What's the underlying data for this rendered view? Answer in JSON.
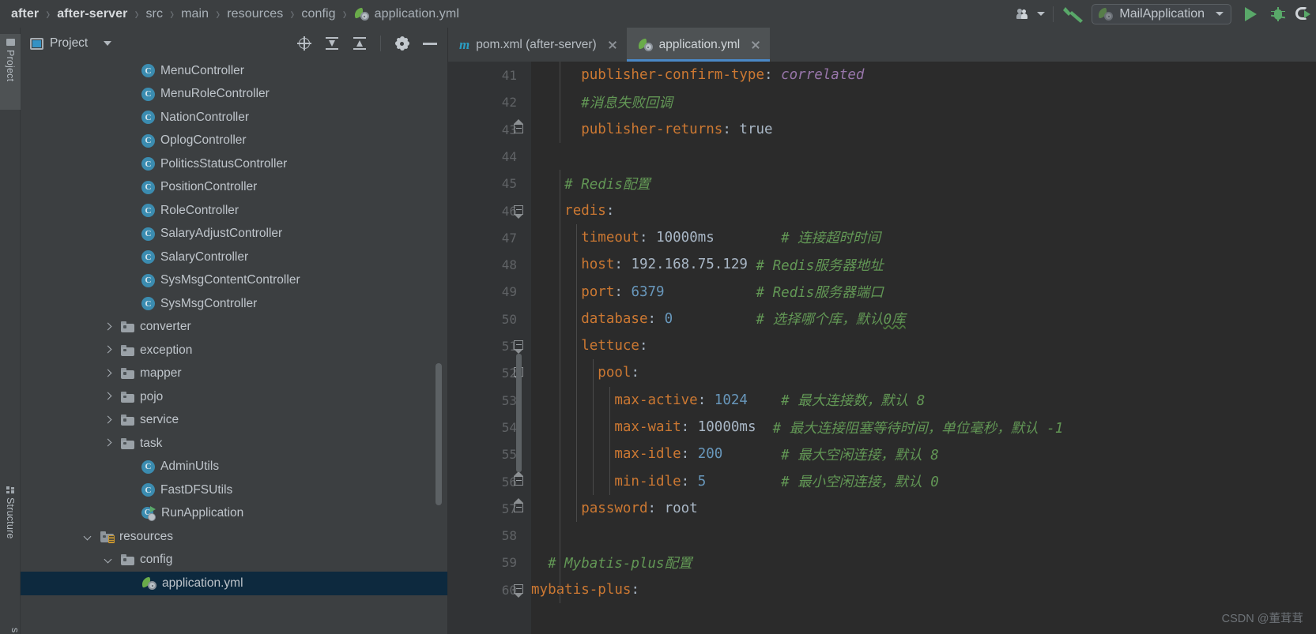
{
  "breadcrumb": {
    "items": [
      "after",
      "after-server",
      "src",
      "main",
      "resources",
      "config"
    ],
    "file": "application.yml",
    "separator": "›"
  },
  "toolbar": {
    "people_icon": "people-icon",
    "build_icon": "hammer-icon",
    "run_config": "MailApplication",
    "run_icon": "run-icon",
    "debug_icon": "debug-icon",
    "coverage_icon": "coverage-icon"
  },
  "left_strip": {
    "project_label": "Project",
    "structure_label": "Structure",
    "bottom_label": "s"
  },
  "project_panel": {
    "title": "Project",
    "tools": [
      "locate-icon",
      "collapse-all-icon",
      "expand-all-icon",
      "settings-icon",
      "hide-icon"
    ],
    "tree": [
      {
        "label": "MenuController",
        "icon": "class",
        "indent": 5,
        "expander": "none"
      },
      {
        "label": "MenuRoleController",
        "icon": "class",
        "indent": 5,
        "expander": "none"
      },
      {
        "label": "NationController",
        "icon": "class",
        "indent": 5,
        "expander": "none"
      },
      {
        "label": "OplogController",
        "icon": "class",
        "indent": 5,
        "expander": "none"
      },
      {
        "label": "PoliticsStatusController",
        "icon": "class",
        "indent": 5,
        "expander": "none"
      },
      {
        "label": "PositionController",
        "icon": "class",
        "indent": 5,
        "expander": "none"
      },
      {
        "label": "RoleController",
        "icon": "class",
        "indent": 5,
        "expander": "none"
      },
      {
        "label": "SalaryAdjustController",
        "icon": "class",
        "indent": 5,
        "expander": "none"
      },
      {
        "label": "SalaryController",
        "icon": "class",
        "indent": 5,
        "expander": "none"
      },
      {
        "label": "SysMsgContentController",
        "icon": "class",
        "indent": 5,
        "expander": "none"
      },
      {
        "label": "SysMsgController",
        "icon": "class",
        "indent": 5,
        "expander": "none"
      },
      {
        "label": "converter",
        "icon": "folder",
        "indent": 4,
        "expander": "right"
      },
      {
        "label": "exception",
        "icon": "folder",
        "indent": 4,
        "expander": "right"
      },
      {
        "label": "mapper",
        "icon": "folder",
        "indent": 4,
        "expander": "right"
      },
      {
        "label": "pojo",
        "icon": "folder",
        "indent": 4,
        "expander": "right"
      },
      {
        "label": "service",
        "icon": "folder",
        "indent": 4,
        "expander": "right"
      },
      {
        "label": "task",
        "icon": "folder",
        "indent": 4,
        "expander": "right"
      },
      {
        "label": "AdminUtils",
        "icon": "class",
        "indent": 5,
        "expander": "none"
      },
      {
        "label": "FastDFSUtils",
        "icon": "class",
        "indent": 5,
        "expander": "none"
      },
      {
        "label": "RunApplication",
        "icon": "runclass",
        "indent": 5,
        "expander": "none"
      },
      {
        "label": "resources",
        "icon": "resfolder",
        "indent": 3,
        "expander": "down"
      },
      {
        "label": "config",
        "icon": "folder",
        "indent": 4,
        "expander": "down"
      },
      {
        "label": "application.yml",
        "icon": "yml",
        "indent": 5,
        "expander": "none",
        "selected": true
      }
    ]
  },
  "editor": {
    "tabs": [
      {
        "label": "pom.xml (after-server)",
        "icon": "maven-icon",
        "active": false,
        "closable": true
      },
      {
        "label": "application.yml",
        "icon": "spring-yml-icon",
        "active": true,
        "closable": true
      }
    ],
    "first_line_number": 41,
    "lines": [
      {
        "n": 41,
        "fold": "none",
        "indent": 6,
        "tokens": [
          {
            "t": "publisher-confirm-type",
            "c": "k"
          },
          {
            "t": ": ",
            "c": "pnc"
          },
          {
            "t": "correlated",
            "c": "val-it"
          }
        ]
      },
      {
        "n": 42,
        "fold": "none",
        "indent": 6,
        "tokens": [
          {
            "t": "#消息失败回调",
            "c": "cmt"
          }
        ]
      },
      {
        "n": 43,
        "fold": "end",
        "indent": 6,
        "tokens": [
          {
            "t": "publisher-returns",
            "c": "k"
          },
          {
            "t": ": ",
            "c": "pnc"
          },
          {
            "t": "true",
            "c": "str"
          }
        ]
      },
      {
        "n": 44,
        "fold": "none",
        "indent": 0,
        "tokens": []
      },
      {
        "n": 45,
        "fold": "none",
        "indent": 4,
        "tokens": [
          {
            "t": "# Redis配置",
            "c": "cmt"
          }
        ]
      },
      {
        "n": 46,
        "fold": "start",
        "indent": 4,
        "tokens": [
          {
            "t": "redis",
            "c": "k"
          },
          {
            "t": ":",
            "c": "pnc"
          }
        ]
      },
      {
        "n": 47,
        "fold": "none",
        "indent": 6,
        "tokens": [
          {
            "t": "timeout",
            "c": "k"
          },
          {
            "t": ": ",
            "c": "pnc"
          },
          {
            "t": "10000ms",
            "c": "str"
          },
          {
            "t": "        # 连接超时时间",
            "c": "cmt"
          }
        ]
      },
      {
        "n": 48,
        "fold": "none",
        "indent": 6,
        "tokens": [
          {
            "t": "host",
            "c": "k"
          },
          {
            "t": ": ",
            "c": "pnc"
          },
          {
            "t": "192.168.75.129",
            "c": "str"
          },
          {
            "t": " # Redis服务器地址",
            "c": "cmt"
          }
        ]
      },
      {
        "n": 49,
        "fold": "none",
        "indent": 6,
        "tokens": [
          {
            "t": "port",
            "c": "k"
          },
          {
            "t": ": ",
            "c": "pnc"
          },
          {
            "t": "6379",
            "c": "num"
          },
          {
            "t": "           # Redis服务器端口",
            "c": "cmt"
          }
        ]
      },
      {
        "n": 50,
        "fold": "none",
        "indent": 6,
        "tokens": [
          {
            "t": "database",
            "c": "k"
          },
          {
            "t": ": ",
            "c": "pnc"
          },
          {
            "t": "0",
            "c": "num"
          },
          {
            "t": "          # 选择哪个库，默认",
            "c": "cmt"
          },
          {
            "t": "0库",
            "c": "cmt typo"
          }
        ]
      },
      {
        "n": 51,
        "fold": "start",
        "indent": 6,
        "tokens": [
          {
            "t": "lettuce",
            "c": "k"
          },
          {
            "t": ":",
            "c": "pnc"
          }
        ]
      },
      {
        "n": 52,
        "fold": "start",
        "indent": 8,
        "tokens": [
          {
            "t": "pool",
            "c": "k"
          },
          {
            "t": ":",
            "c": "pnc"
          }
        ]
      },
      {
        "n": 53,
        "fold": "none",
        "indent": 10,
        "tokens": [
          {
            "t": "max-active",
            "c": "k"
          },
          {
            "t": ": ",
            "c": "pnc"
          },
          {
            "t": "1024",
            "c": "num"
          },
          {
            "t": "    # 最大连接数，默认 8",
            "c": "cmt"
          }
        ]
      },
      {
        "n": 54,
        "fold": "none",
        "indent": 10,
        "tokens": [
          {
            "t": "max-wait",
            "c": "k"
          },
          {
            "t": ": ",
            "c": "pnc"
          },
          {
            "t": "10000ms",
            "c": "str"
          },
          {
            "t": "  # 最大连接阻塞等待时间，单位毫秒，默认 -1",
            "c": "cmt"
          }
        ]
      },
      {
        "n": 55,
        "fold": "none",
        "indent": 10,
        "tokens": [
          {
            "t": "max-idle",
            "c": "k"
          },
          {
            "t": ": ",
            "c": "pnc"
          },
          {
            "t": "200",
            "c": "num"
          },
          {
            "t": "       # 最大空闲连接，默认 8",
            "c": "cmt"
          }
        ]
      },
      {
        "n": 56,
        "fold": "end",
        "indent": 10,
        "tokens": [
          {
            "t": "min-idle",
            "c": "k"
          },
          {
            "t": ": ",
            "c": "pnc"
          },
          {
            "t": "5",
            "c": "num"
          },
          {
            "t": "         # 最小空闲连接，默认 0",
            "c": "cmt"
          }
        ]
      },
      {
        "n": 57,
        "fold": "end",
        "indent": 6,
        "tokens": [
          {
            "t": "password",
            "c": "k"
          },
          {
            "t": ": ",
            "c": "pnc"
          },
          {
            "t": "root",
            "c": "str"
          }
        ]
      },
      {
        "n": 58,
        "fold": "none",
        "indent": 0,
        "tokens": []
      },
      {
        "n": 59,
        "fold": "none",
        "indent": 2,
        "tokens": [
          {
            "t": "# Mybatis-plus配置",
            "c": "cmt"
          }
        ]
      },
      {
        "n": 60,
        "fold": "start",
        "indent": 0,
        "tokens": [
          {
            "t": "mybatis-plus",
            "c": "k"
          },
          {
            "t": ":",
            "c": "pnc"
          }
        ]
      }
    ]
  },
  "watermark": "CSDN @董茸茸",
  "colors": {
    "editor_bg": "#2b2b2b",
    "panel_bg": "#3c3f41",
    "gutter_bg": "#313335",
    "selection_blue": "#0d293e",
    "tab_underline": "#4a88c7",
    "key_orange": "#cc7832",
    "number_blue": "#6897bb",
    "comment_green": "#629755",
    "value_purple": "#9876aa",
    "plain_text": "#a9b7c6",
    "run_green": "#59a869",
    "class_icon_blue": "#3b8cb0"
  }
}
